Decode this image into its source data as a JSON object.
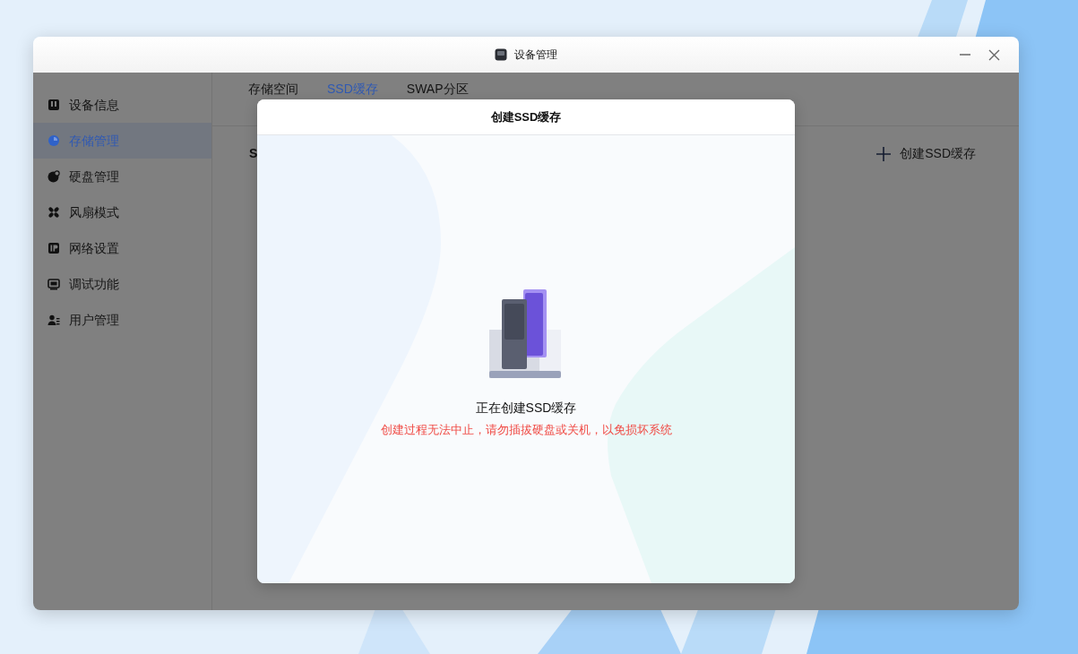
{
  "window": {
    "title": "设备管理"
  },
  "sidebar": {
    "items": [
      {
        "label": "设备信息",
        "selected": false
      },
      {
        "label": "存储管理",
        "selected": true
      },
      {
        "label": "硬盘管理",
        "selected": false
      },
      {
        "label": "风扇模式",
        "selected": false
      },
      {
        "label": "网络设置",
        "selected": false
      },
      {
        "label": "调试功能",
        "selected": false
      },
      {
        "label": "用户管理",
        "selected": false
      }
    ]
  },
  "tabs": [
    {
      "label": "存储空间",
      "selected": false
    },
    {
      "label": "SSD缓存",
      "selected": true
    },
    {
      "label": "SWAP分区",
      "selected": false
    }
  ],
  "section_title": "S",
  "create_button": "创建SSD缓存",
  "dialog": {
    "title": "创建SSD缓存",
    "status": "正在创建SSD缓存",
    "warning": "创建过程无法中止，请勿插拔硬盘或关机，以免损坏系统"
  }
}
